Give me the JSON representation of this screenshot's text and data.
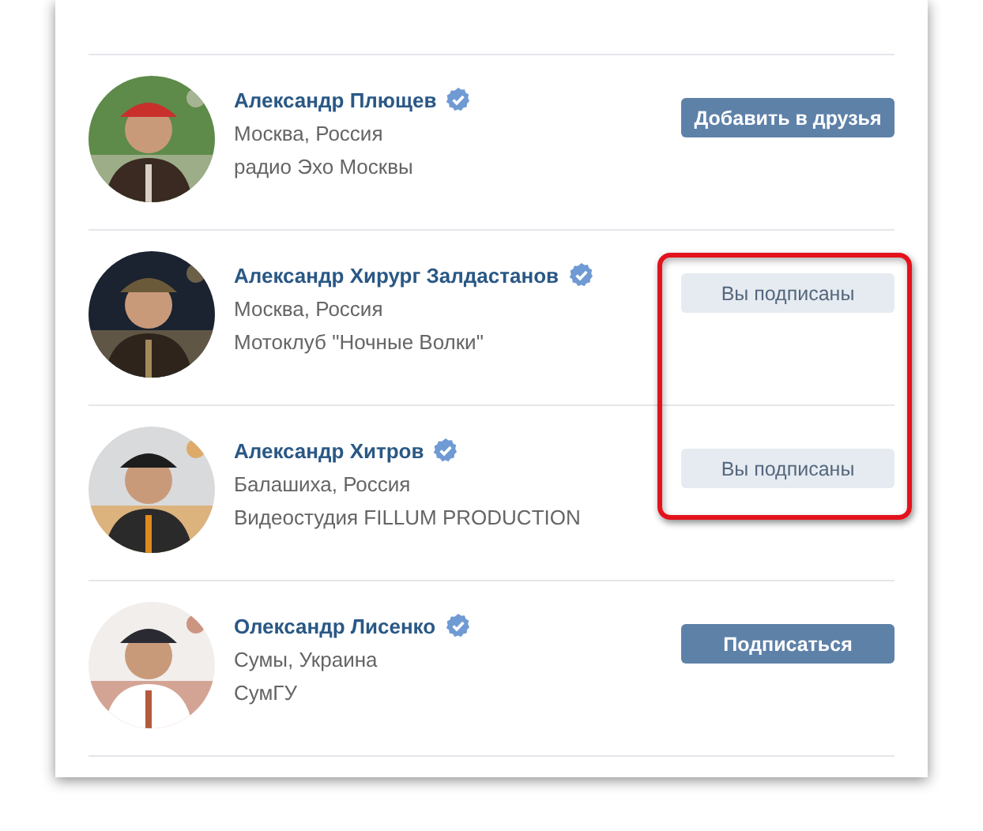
{
  "people": [
    {
      "name": "Александр Плющев",
      "verified": true,
      "location": "Москва, Россия",
      "about": "радио Эхо Москвы",
      "button": {
        "label": "Добавить в друзья",
        "kind": "primary"
      },
      "highlighted": false
    },
    {
      "name": "Александр Хирург Залдастанов",
      "verified": true,
      "location": "Москва, Россия",
      "about": "Мотоклуб \"Ночные Волки\"",
      "button": {
        "label": "Вы подписаны",
        "kind": "secondary"
      },
      "highlighted": true
    },
    {
      "name": "Александр Хитров",
      "verified": true,
      "location": "Балашиха, Россия",
      "about": "Видеостудия FILLUM PRODUCTION",
      "button": {
        "label": "Вы подписаны",
        "kind": "secondary"
      },
      "highlighted": true
    },
    {
      "name": "Олександр Лисенко",
      "verified": true,
      "location": "Сумы, Украина",
      "about": "СумГУ",
      "button": {
        "label": "Подписаться",
        "kind": "primary"
      },
      "highlighted": false
    }
  ]
}
